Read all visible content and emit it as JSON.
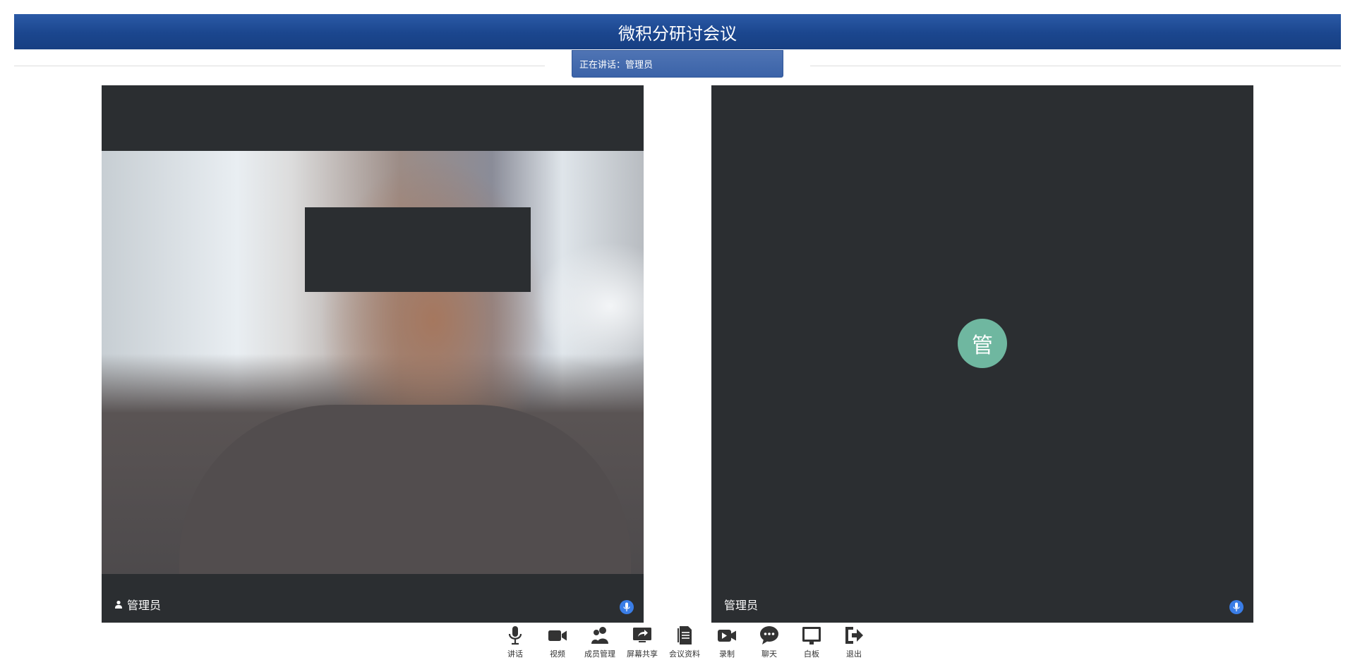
{
  "header": {
    "title": "微积分研讨会议"
  },
  "speaking": {
    "label": "正在讲话：管理员"
  },
  "tiles": [
    {
      "name": "管理员",
      "mic": "mic-icon"
    },
    {
      "name": "管理员",
      "avatar_text": "管",
      "avatar_color": "#6fb7a0",
      "mic": "mic-icon"
    }
  ],
  "toolbar": {
    "items": [
      {
        "label": "讲话",
        "icon": "microphone-icon"
      },
      {
        "label": "视频",
        "icon": "video-camera-icon"
      },
      {
        "label": "成员管理",
        "icon": "members-icon"
      },
      {
        "label": "屏幕共享",
        "icon": "screen-share-icon"
      },
      {
        "label": "会议资料",
        "icon": "documents-icon"
      },
      {
        "label": "录制",
        "icon": "record-icon"
      },
      {
        "label": "聊天",
        "icon": "chat-icon"
      },
      {
        "label": "白板",
        "icon": "whiteboard-icon"
      },
      {
        "label": "退出",
        "icon": "exit-icon"
      }
    ]
  },
  "colors": {
    "header_blue": "#1b468e",
    "tile_bg": "#2b2e31",
    "mic_blue": "#3a7de6",
    "avatar_green": "#6fb7a0"
  }
}
